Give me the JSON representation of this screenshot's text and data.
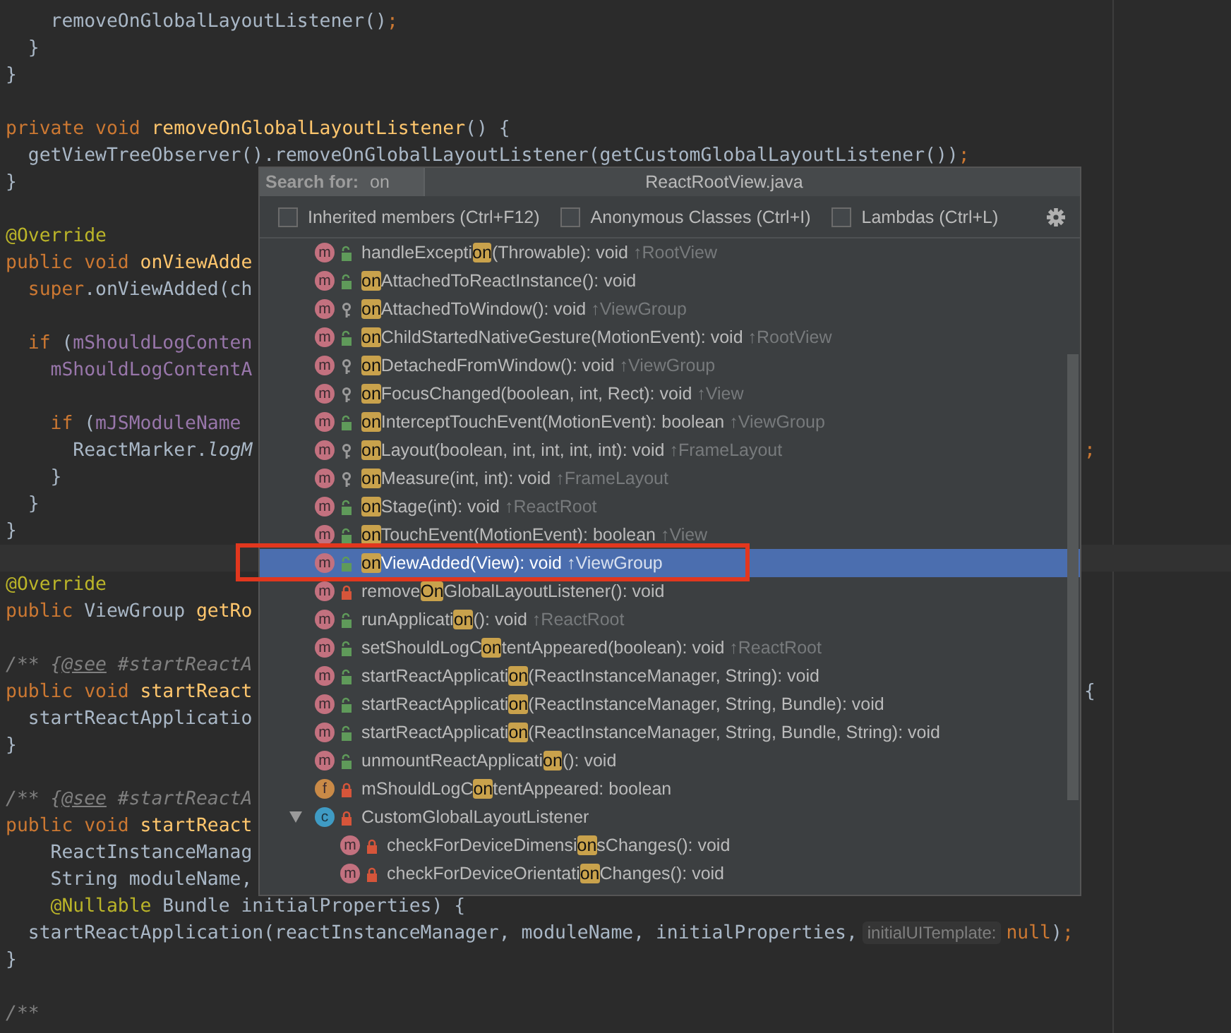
{
  "editor": {
    "lines": [
      {
        "kind": "code",
        "segments": [
          {
            "kind": "plain",
            "text": "    removeOnGlobalLayoutListener()"
          },
          {
            "kind": "keyword",
            "text": ";"
          }
        ]
      },
      {
        "kind": "code",
        "segments": [
          {
            "kind": "plain",
            "text": "  }"
          }
        ]
      },
      {
        "kind": "code",
        "segments": [
          {
            "kind": "plain",
            "text": "}"
          }
        ]
      },
      {
        "kind": "blank"
      },
      {
        "kind": "code",
        "segments": [
          {
            "kind": "keyword",
            "text": "private void "
          },
          {
            "kind": "method",
            "text": "removeOnGlobalLayoutListener"
          },
          {
            "kind": "plain",
            "text": "() {"
          }
        ]
      },
      {
        "kind": "code",
        "segments": [
          {
            "kind": "plain",
            "text": "  getViewTreeObserver().removeOnGlobalLayoutListener(getCustomGlobalLayoutListener())"
          },
          {
            "kind": "keyword",
            "text": ";"
          }
        ]
      },
      {
        "kind": "code",
        "segments": [
          {
            "kind": "plain",
            "text": "}"
          }
        ]
      },
      {
        "kind": "blank"
      },
      {
        "kind": "code",
        "segments": [
          {
            "kind": "annotation",
            "text": "@Override"
          }
        ]
      },
      {
        "kind": "code",
        "segments": [
          {
            "kind": "keyword",
            "text": "public void "
          },
          {
            "kind": "method",
            "text": "onViewAdde"
          }
        ]
      },
      {
        "kind": "code",
        "segments": [
          {
            "kind": "keyword",
            "text": "  super"
          },
          {
            "kind": "plain",
            "text": ".onViewAdded(ch"
          }
        ]
      },
      {
        "kind": "blank"
      },
      {
        "kind": "code",
        "segments": [
          {
            "kind": "keyword",
            "text": "  if"
          },
          {
            "kind": "plain",
            "text": " ("
          },
          {
            "kind": "field",
            "text": "mShouldLogConten"
          }
        ]
      },
      {
        "kind": "code",
        "segments": [
          {
            "kind": "field",
            "text": "    mShouldLogContentA"
          }
        ]
      },
      {
        "kind": "blank"
      },
      {
        "kind": "code",
        "segments": [
          {
            "kind": "keyword",
            "text": "    if"
          },
          {
            "kind": "plain",
            "text": " ("
          },
          {
            "kind": "field",
            "text": "mJSModuleName"
          }
        ]
      },
      {
        "kind": "code",
        "segments": [
          {
            "kind": "plain",
            "text": "      ReactMarker."
          },
          {
            "kind": "static",
            "text": "logM"
          }
        ],
        "tail": [
          {
            "kind": "keyword",
            "text": ";"
          }
        ]
      },
      {
        "kind": "code",
        "segments": [
          {
            "kind": "plain",
            "text": "    }"
          }
        ]
      },
      {
        "kind": "code",
        "segments": [
          {
            "kind": "plain",
            "text": "  }"
          }
        ]
      },
      {
        "kind": "code",
        "segments": [
          {
            "kind": "plain",
            "text": "}"
          }
        ]
      },
      {
        "kind": "caret_line"
      },
      {
        "kind": "code",
        "segments": [
          {
            "kind": "annotation",
            "text": "@Override"
          }
        ]
      },
      {
        "kind": "code",
        "segments": [
          {
            "kind": "keyword",
            "text": "public"
          },
          {
            "kind": "plain",
            "text": " ViewGroup "
          },
          {
            "kind": "method",
            "text": "getRo"
          }
        ]
      },
      {
        "kind": "blank"
      },
      {
        "kind": "code",
        "segments": [
          {
            "kind": "comment",
            "text": "/** {"
          },
          {
            "kind": "doc_tag",
            "text": "@see"
          },
          {
            "kind": "comment",
            "text": " #startReactA"
          }
        ]
      },
      {
        "kind": "code",
        "segments": [
          {
            "kind": "keyword",
            "text": "public void "
          },
          {
            "kind": "method",
            "text": "startReact"
          }
        ],
        "tail": [
          {
            "kind": "plain",
            "text": "{"
          }
        ]
      },
      {
        "kind": "code",
        "segments": [
          {
            "kind": "plain",
            "text": "  startReactApplicatio"
          }
        ]
      },
      {
        "kind": "code",
        "segments": [
          {
            "kind": "plain",
            "text": "}"
          }
        ]
      },
      {
        "kind": "blank"
      },
      {
        "kind": "code",
        "segments": [
          {
            "kind": "comment",
            "text": "/** {"
          },
          {
            "kind": "doc_tag",
            "text": "@see"
          },
          {
            "kind": "comment",
            "text": " #startReactA"
          }
        ]
      },
      {
        "kind": "code",
        "segments": [
          {
            "kind": "keyword",
            "text": "public void "
          },
          {
            "kind": "method",
            "text": "startReact"
          }
        ]
      },
      {
        "kind": "code",
        "segments": [
          {
            "kind": "plain",
            "text": "    ReactInstanceManag"
          }
        ]
      },
      {
        "kind": "code",
        "segments": [
          {
            "kind": "plain",
            "text": "    String moduleName,"
          }
        ]
      },
      {
        "kind": "code",
        "segments": [
          {
            "kind": "annotation",
            "text": "    @Nullable"
          },
          {
            "kind": "plain",
            "text": " Bundle initialProperties) {"
          }
        ]
      },
      {
        "kind": "code",
        "segments": [
          {
            "kind": "plain",
            "text": "  startReactApplication(reactInstanceManager, moduleName, initialProperties, "
          },
          {
            "kind": "hint",
            "text": "initialUITemplate:"
          },
          {
            "kind": "keyword",
            "text": "null"
          },
          {
            "kind": "plain",
            "text": ")"
          },
          {
            "kind": "keyword",
            "text": ";"
          }
        ]
      },
      {
        "kind": "code",
        "segments": [
          {
            "kind": "plain",
            "text": "}"
          }
        ]
      },
      {
        "kind": "blank"
      },
      {
        "kind": "code",
        "segments": [
          {
            "kind": "comment",
            "text": "/**"
          }
        ]
      }
    ]
  },
  "popup": {
    "search": {
      "label": "Search for:",
      "value": "on"
    },
    "title": "ReactRootView.java",
    "options": [
      {
        "label": "Inherited members (Ctrl+F12)",
        "checked": false
      },
      {
        "label": "Anonymous Classes (Ctrl+I)",
        "checked": false
      },
      {
        "label": "Lambdas (Ctrl+L)",
        "checked": false
      }
    ],
    "members": [
      {
        "kind": "method",
        "letter": "m",
        "access": {
          "kind": "public"
        },
        "prefix": "handleExcepti",
        "match": "on",
        "suffix": "(Throwable): void",
        "origin": "↑RootView",
        "selected": false,
        "marked": false
      },
      {
        "kind": "method",
        "letter": "m",
        "access": {
          "kind": "public"
        },
        "match": "on",
        "suffix": "AttachedToReactInstance(): void",
        "selected": false,
        "marked": false
      },
      {
        "kind": "method",
        "letter": "m",
        "access": {
          "kind": "protected"
        },
        "match": "on",
        "suffix": "AttachedToWindow(): void",
        "origin": "↑ViewGroup",
        "selected": false,
        "marked": false
      },
      {
        "kind": "method",
        "letter": "m",
        "access": {
          "kind": "public"
        },
        "match": "on",
        "suffix": "ChildStartedNativeGesture(MotionEvent): void",
        "origin": "↑RootView",
        "selected": false,
        "marked": false
      },
      {
        "kind": "method",
        "letter": "m",
        "access": {
          "kind": "protected"
        },
        "match": "on",
        "suffix": "DetachedFromWindow(): void",
        "origin": "↑ViewGroup",
        "selected": false,
        "marked": false
      },
      {
        "kind": "method",
        "letter": "m",
        "access": {
          "kind": "protected"
        },
        "match": "on",
        "suffix": "FocusChanged(boolean, int, Rect): void",
        "origin": "↑View",
        "selected": false,
        "marked": false
      },
      {
        "kind": "method",
        "letter": "m",
        "access": {
          "kind": "public"
        },
        "match": "on",
        "suffix": "InterceptTouchEvent(MotionEvent): boolean",
        "origin": "↑ViewGroup",
        "selected": false,
        "marked": false
      },
      {
        "kind": "method",
        "letter": "m",
        "access": {
          "kind": "protected"
        },
        "match": "on",
        "suffix": "Layout(boolean, int, int, int, int): void",
        "origin": "↑FrameLayout",
        "selected": false,
        "marked": false
      },
      {
        "kind": "method",
        "letter": "m",
        "access": {
          "kind": "protected"
        },
        "match": "on",
        "suffix": "Measure(int, int): void",
        "origin": "↑FrameLayout",
        "selected": false,
        "marked": false
      },
      {
        "kind": "method",
        "letter": "m",
        "access": {
          "kind": "public"
        },
        "match": "on",
        "suffix": "Stage(int): void",
        "origin": "↑ReactRoot",
        "selected": false,
        "marked": false
      },
      {
        "kind": "method",
        "letter": "m",
        "access": {
          "kind": "public"
        },
        "match": "on",
        "suffix": "TouchEvent(MotionEvent): boolean",
        "origin": "↑View",
        "selected": false,
        "marked": false
      },
      {
        "kind": "method",
        "letter": "m",
        "access": {
          "kind": "public"
        },
        "match": "on",
        "suffix": "ViewAdded(View): void",
        "origin": "↑ViewGroup",
        "selected": true,
        "marked": true
      },
      {
        "kind": "method",
        "letter": "m",
        "access": {
          "kind": "private"
        },
        "prefix": "remove",
        "match": "On",
        "suffix": "GlobalLayoutListener(): void",
        "selected": false,
        "marked": false
      },
      {
        "kind": "method",
        "letter": "m",
        "access": {
          "kind": "public"
        },
        "prefix": "runApplicati",
        "match": "on",
        "suffix": "(): void",
        "origin": "↑ReactRoot",
        "selected": false,
        "marked": false
      },
      {
        "kind": "method",
        "letter": "m",
        "access": {
          "kind": "public"
        },
        "prefix": "setShouldLogC",
        "match": "on",
        "suffix": "tentAppeared(boolean): void",
        "origin": "↑ReactRoot",
        "selected": false,
        "marked": false
      },
      {
        "kind": "method",
        "letter": "m",
        "access": {
          "kind": "public"
        },
        "prefix": "startReactApplicati",
        "match": "on",
        "suffix": "(ReactInstanceManager, String): void",
        "selected": false,
        "marked": false
      },
      {
        "kind": "method",
        "letter": "m",
        "access": {
          "kind": "public"
        },
        "prefix": "startReactApplicati",
        "match": "on",
        "suffix": "(ReactInstanceManager, String, Bundle): void",
        "selected": false,
        "marked": false
      },
      {
        "kind": "method",
        "letter": "m",
        "access": {
          "kind": "public"
        },
        "prefix": "startReactApplicati",
        "match": "on",
        "suffix": "(ReactInstanceManager, String, Bundle, String): void",
        "selected": false,
        "marked": false
      },
      {
        "kind": "method",
        "letter": "m",
        "access": {
          "kind": "public"
        },
        "prefix": "unmountReactApplicati",
        "match": "on",
        "suffix": "(): void",
        "selected": false,
        "marked": false
      },
      {
        "kind": "field",
        "letter": "f",
        "access": {
          "kind": "private"
        },
        "prefix": "mShouldLogC",
        "match": "on",
        "suffix": "tentAppeared: boolean",
        "selected": false,
        "marked": false
      },
      {
        "kind": "class",
        "letter": "c",
        "access": {
          "kind": "private"
        },
        "prefix": "CustomGlobalLayoutListener",
        "selected": false,
        "marked": false,
        "expanded": true,
        "children": [
          {
            "kind": "method",
            "letter": "m",
            "access": {
              "kind": "private"
            },
            "prefix": "checkForDeviceDimensi",
            "match": "on",
            "suffix": "sChanges(): void",
            "selected": false,
            "marked": false
          },
          {
            "kind": "method",
            "letter": "m",
            "access": {
              "kind": "private"
            },
            "prefix": "checkForDeviceOrientati",
            "match": "on",
            "suffix": "Changes(): void",
            "selected": false,
            "marked": false
          }
        ]
      }
    ]
  }
}
